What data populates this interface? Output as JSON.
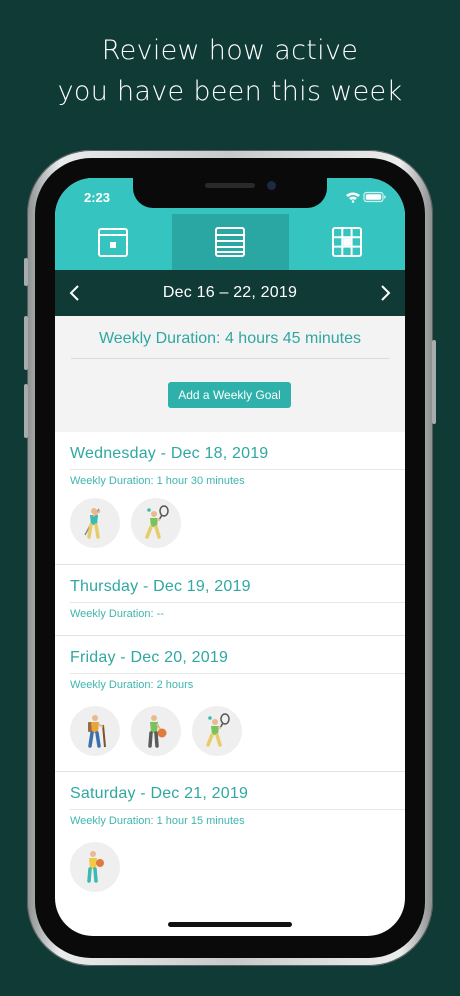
{
  "headline": {
    "line1": "Review how active",
    "line2": "you have been this week"
  },
  "status": {
    "time": "2:23"
  },
  "tabs": [
    {
      "name": "calendar-day-icon",
      "active": false
    },
    {
      "name": "list-icon",
      "active": true
    },
    {
      "name": "calendar-grid-icon",
      "active": false
    }
  ],
  "nav": {
    "date_range": "Dec 16 – 22, 2019"
  },
  "summary": {
    "weekly_total": "Weekly Duration: 4 hours 45 minutes",
    "goal_button": "Add a Weekly Goal"
  },
  "days": [
    {
      "title": "Wednesday - Dec 18, 2019",
      "duration": "Weekly Duration: 1 hour 30 minutes",
      "activities": [
        "golf-icon",
        "tennis-icon"
      ]
    },
    {
      "title": "Thursday - Dec 19, 2019",
      "duration": "Weekly Duration: --",
      "activities": []
    },
    {
      "title": "Friday - Dec 20, 2019",
      "duration": "Weekly Duration: 2 hours",
      "activities": [
        "hiking-icon",
        "bowling-icon",
        "tennis-icon"
      ]
    },
    {
      "title": "Saturday - Dec 21, 2019",
      "duration": "Weekly Duration: 1 hour 15 minutes",
      "activities": [
        "basketball-icon"
      ]
    }
  ],
  "colors": {
    "accent": "#35c4bf",
    "accent_dark": "#2aa7a2",
    "background": "#0f3a35",
    "text_teal": "#2fa8a2"
  }
}
